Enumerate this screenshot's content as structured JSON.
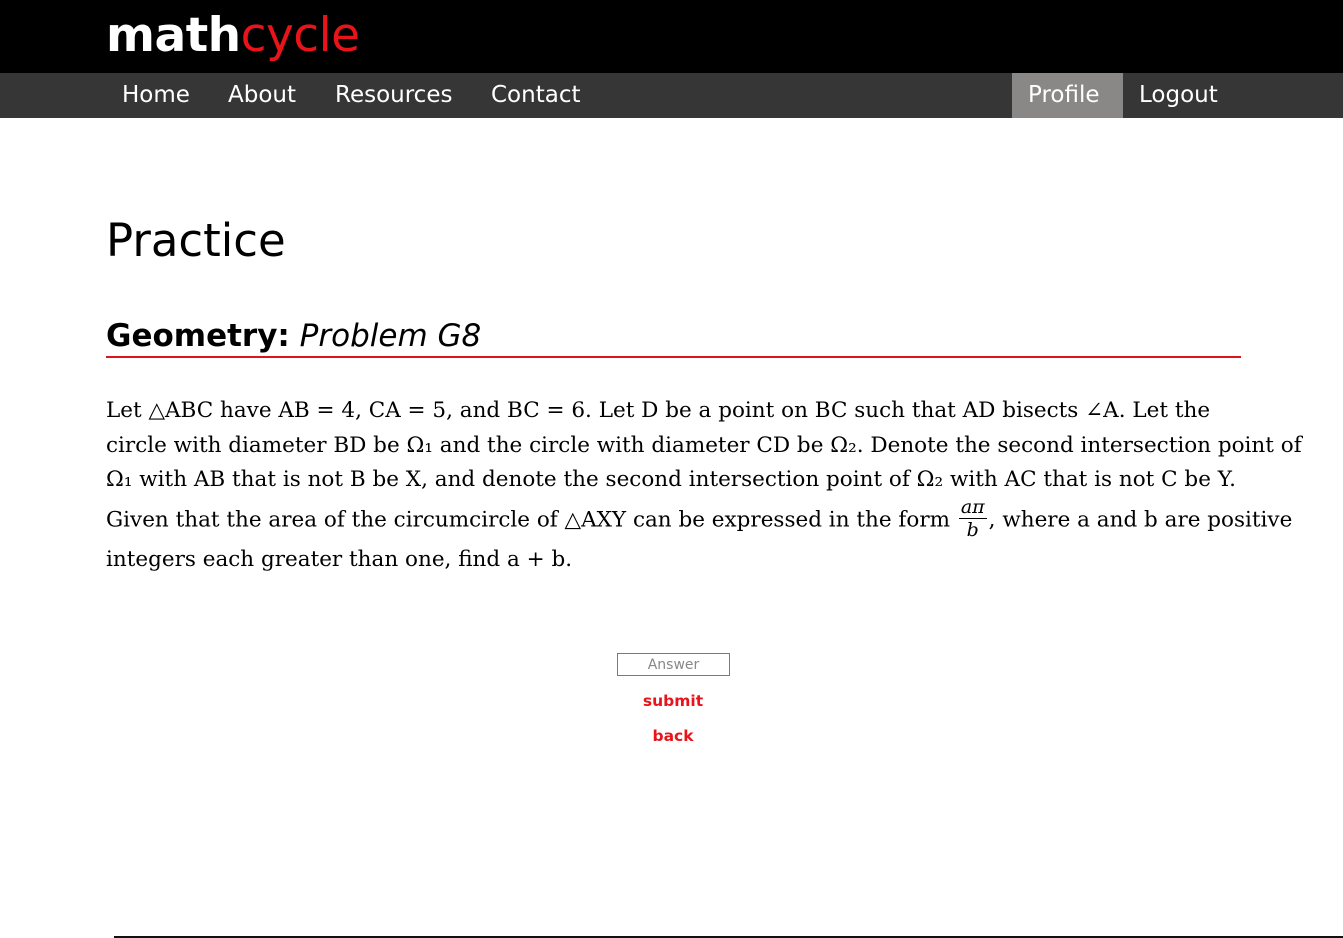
{
  "logo": {
    "part1": "math",
    "part2": "cycle"
  },
  "nav": {
    "left": [
      "Home",
      "About",
      "Resources",
      "Contact"
    ],
    "right": [
      "Profile",
      "Logout"
    ],
    "active": "Profile"
  },
  "page_title": "Practice",
  "problem": {
    "category": "Geometry:",
    "number": "Problem G8",
    "lines": [
      "Let △ABC have AB = 4, CA = 5, and BC = 6. Let D be a point on BC such that AD bisects ∠A. Let the",
      "circle with diameter BD be Ω₁ and the circle with diameter CD be Ω₂. Denote the second intersection point of",
      "Ω₁ with AB that is not B be X, and denote the second intersection point of Ω₂ with AC that is not C be Y.",
      "Given that the area of the circumcircle of △AXY can be expressed in the form",
      ", where a and b are positive",
      "integers each greater than one, find a + b."
    ],
    "fraction": {
      "numerator": "aπ",
      "denominator": "b"
    }
  },
  "answer": {
    "placeholder": "Answer",
    "value": ""
  },
  "buttons": {
    "submit": "submit",
    "back": "back"
  },
  "colors": {
    "accent": "#e8141a",
    "topbar": "#000000",
    "navbar": "#363636",
    "nav_active": "#8a8787",
    "rule": "#d8161c"
  }
}
